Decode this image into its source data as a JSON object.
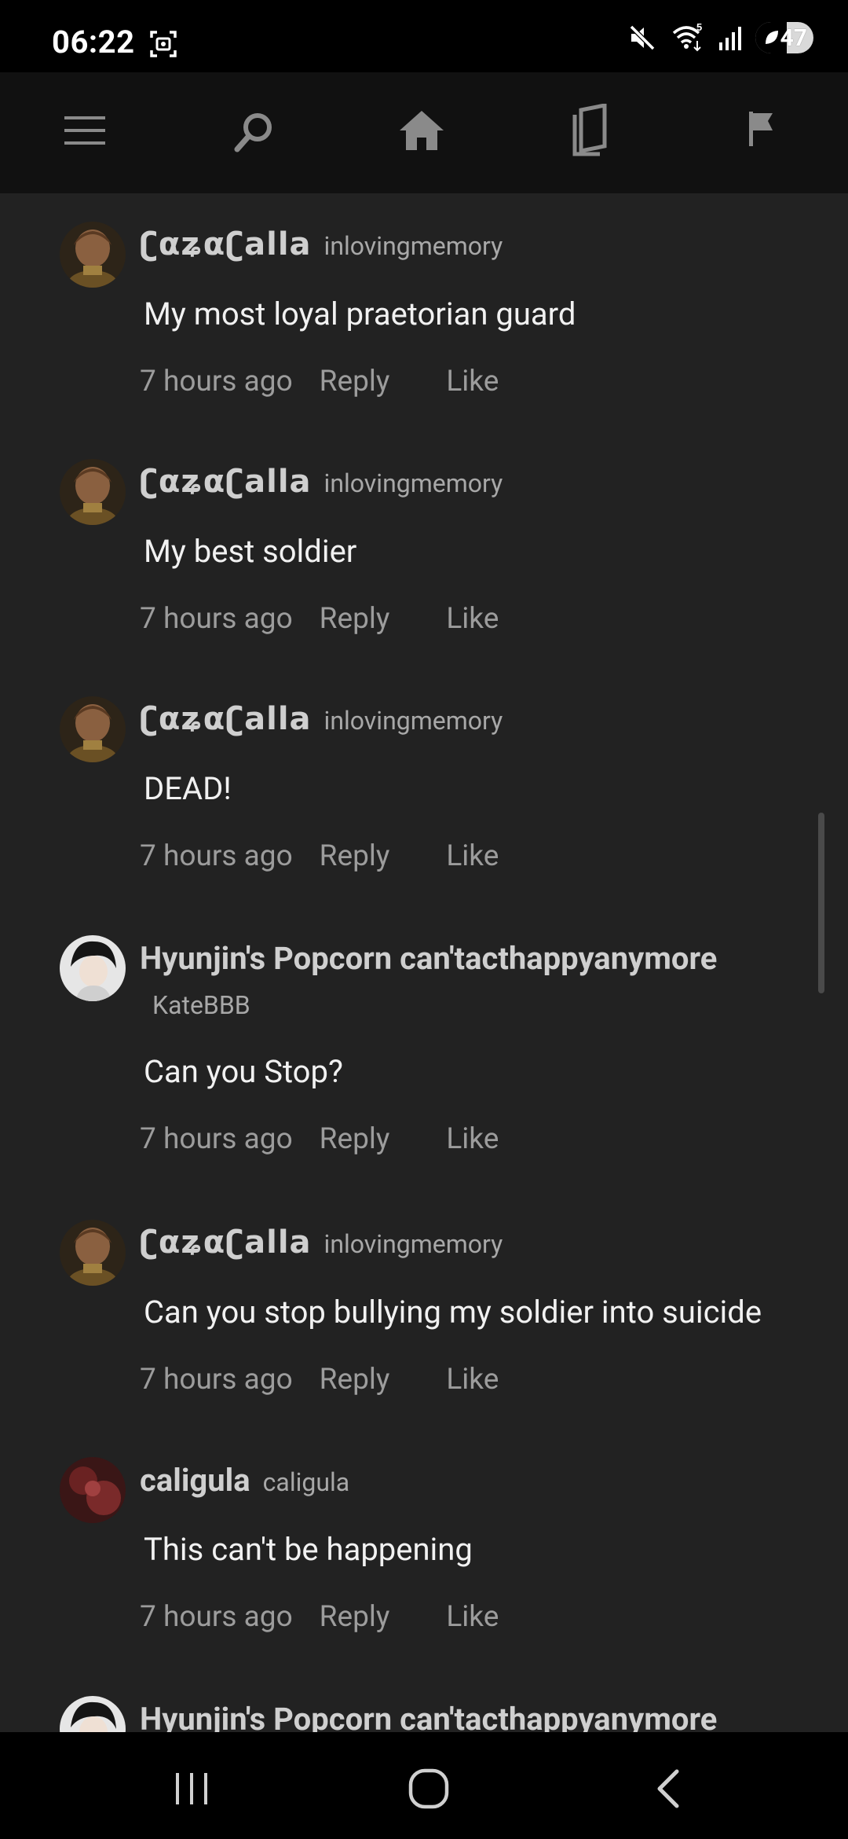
{
  "status": {
    "time": "06:22",
    "battery": "47",
    "icons": [
      "screenshot-icon",
      "mute-icon",
      "wifi-icon",
      "signal-icon",
      "battery-icon"
    ]
  },
  "nav": {
    "icons": [
      "menu-icon",
      "search-icon",
      "home-icon",
      "library-icon",
      "flag-icon"
    ]
  },
  "comments": [
    {
      "name": "ʗαʑαʗalla",
      "handle": "inlovingmemory",
      "text": "My most loyal praetorian guard",
      "time": "7 hours ago",
      "reply": "Reply",
      "like": "Like"
    },
    {
      "name": "ʗαʑαʗalla",
      "handle": "inlovingmemory",
      "text": "My best soldier",
      "time": "7 hours ago",
      "reply": "Reply",
      "like": "Like"
    },
    {
      "name": "ʗαʑαʗalla",
      "handle": "inlovingmemory",
      "text": "DEAD!",
      "time": "7 hours ago",
      "reply": "Reply",
      "like": "Like"
    },
    {
      "name": "Hyunjin's Popcorn can'tacthappyanymore",
      "handle": "KateBBB",
      "text": "Can you Stop?",
      "time": "7 hours ago",
      "reply": "Reply",
      "like": "Like"
    },
    {
      "name": "ʗαʑαʗalla",
      "handle": "inlovingmemory",
      "text": "Can you stop bullying my soldier into suicide",
      "time": "7 hours ago",
      "reply": "Reply",
      "like": "Like"
    },
    {
      "name": "caligula",
      "handle": "caligula",
      "text": "This can't be happening",
      "time": "7 hours ago",
      "reply": "Reply",
      "like": "Like"
    },
    {
      "name": "Hyunjin's Popcorn can'tacthappyanymore"
    }
  ],
  "colors": {
    "background": "#222222",
    "name": "#cfcfcf",
    "meta": "#9c9c9c",
    "text": "#f1f1f1"
  },
  "system_nav": {
    "icons": [
      "recents-icon",
      "home-button-icon",
      "back-icon"
    ]
  }
}
